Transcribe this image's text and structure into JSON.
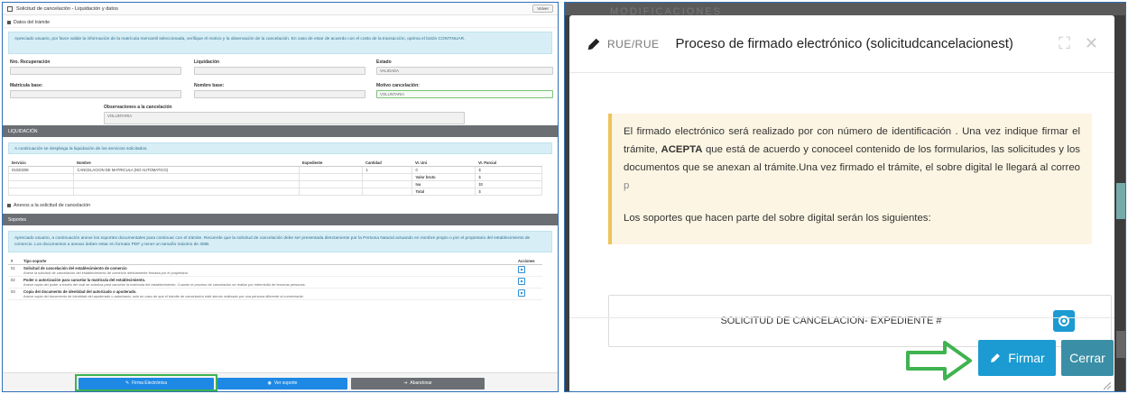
{
  "left": {
    "header": {
      "title": "Solicitud de cancelación - Liquidación y datos",
      "back_label": "Volver"
    },
    "datos_section": "Datos del trámite",
    "intro": "Apreciado usuario, por favor valide la información de la matrícula mercantil seleccionada, verifique el motivo y la observación de la cancelación. En caso de estar de acuerdo con el costo de la transacción, oprima el botón CONTINUAR.",
    "fields": {
      "recuperacion_label": "Nro. Recuperación",
      "recuperacion_value": "",
      "liquidacion_label": "Liquidación",
      "liquidacion_value": "",
      "estado_label": "Estado",
      "estado_value": "VALIDADA",
      "matricula_label": "Matrícula base:",
      "matricula_value": "",
      "nombre_label": "Nombre base:",
      "nombre_value": "",
      "motivo_label": "Motivo cancelación:",
      "motivo_value": "VOLUNTARIA",
      "observaciones_label": "Observaciones a la cancelación",
      "observaciones_value": "VOLUNTARIA"
    },
    "liquidacion_bar": "LIQUIDACIÓN",
    "liquidacion_info": "A continuación se despliega la liquidación de los servicios solicitados.",
    "liq_table": {
      "headers": [
        "Servicio",
        "Nombre",
        "Expediente",
        "Cantidad",
        "Vr. Uni",
        "Vr. Parcial"
      ],
      "row": [
        "01020208",
        "CANCELACION DE MATRICULA (NO AUTOMATICO)",
        "",
        "1",
        "0",
        "$"
      ],
      "valor_bruto_label": "Valor bruto",
      "valor_bruto_value": "$",
      "iva_label": "Iva",
      "iva_value": "$0",
      "total_label": "Total",
      "total_value": "$"
    },
    "anexos_section": "Anexos a la solicitud de cancelación",
    "soportes_bar": "Soportes",
    "soportes_info": "Apreciado usuario, a continuación anexe los soportes documentales para continuar con el trámite. Recuerde que la solicitud de cancelación debe ser presentada directamente por la Persona Natural actuando en nombre propio o por el propietario del establecimiento de comercio. Los documentos a anexar deben estar en formato PDF y tener un tamaño máximo de 4MB.",
    "sop_table": {
      "headers": [
        "#",
        "Tipo soporte",
        "Acciones"
      ],
      "rows": [
        {
          "num": "01",
          "title": "Solicitud de cancelación del establecimiento de comercio",
          "desc": "Anexe la solicitud de cancelación del establecimiento de comercio debidamente firmada por el propietario."
        },
        {
          "num": "02",
          "title": "Poder o autorización para cancelar la matrícula del establecimiento.",
          "desc": "Anexe copia del poder a través del cual se autoriza para cancelar la matrícula del establecimiento. Cuando el proceso de cancelación se realice por intermedio de terceras personas."
        },
        {
          "num": "03",
          "title": "Copia del documento de identidad del autorizado o apoderado.",
          "desc": "Anexe copia del documento de identidad del apoderado o autorizado, solo en caso de que el trámite de cancelación esté siendo realizado por una persona diferente al comerciante."
        }
      ]
    },
    "buttons": {
      "firma": "Firma Electrónica",
      "ver": "Ver soporte",
      "abandonar": "Abandonar"
    }
  },
  "right": {
    "bg_title": "MODIFICACIONES",
    "modal": {
      "prefix_blurred": "RUE/RUE",
      "title": "Proceso de firmado electrónico (solicitudcancelacionest)",
      "warning": {
        "t1": "El firmado electrónico será realizado por ",
        "name": "",
        "t2": " con número de identificación ",
        "idnum": "",
        "t3": ". Una vez indique firmar el trámite, ",
        "acepta": "ACEPTA",
        "t4": " que está de acuerdo y conoceel contenido de los formularios, las solicitudes y los documentos que se anexan al trámite.Una vez firmado el trámite, el sobre digital le llegará al correo ",
        "email": "p",
        "t5": "",
        "soportes": "Los soportes que hacen parte del sobre digital serán los siguientes:"
      },
      "doc_label": "SOLICITUD DE CANCELACION- EXPEDIENTE #",
      "firmar_label": "Firmar",
      "cerrar_label": "Cerrar"
    }
  },
  "colors": {
    "primary": "#1b9bd1",
    "cerrar": "#3a8fa6",
    "highlight": "#3fb34f",
    "panel_border": "#2f6fb8",
    "warning_bg": "#fcf5e3",
    "warning_border": "#efc35a"
  },
  "icons": {
    "pencil": "pencil-icon",
    "eye": "eye-icon",
    "expand": "expand-icon",
    "close": "close-icon",
    "arrow": "arrow-right-icon"
  }
}
